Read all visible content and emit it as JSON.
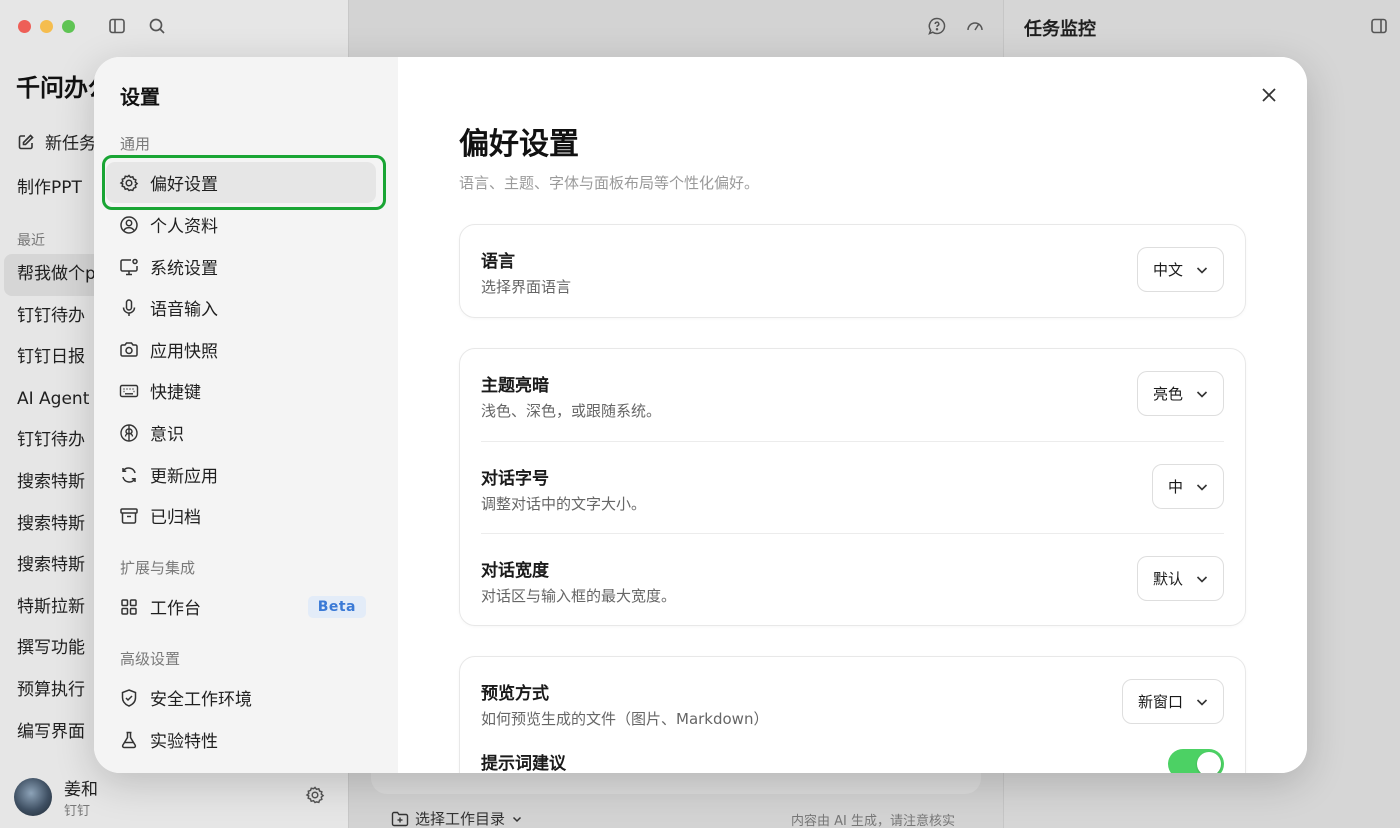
{
  "background": {
    "brand": "千问办公",
    "new_task": "新任务",
    "make_ppt": "制作PPT",
    "recent_label": "最近",
    "recent_items": [
      "帮我做个p",
      "钉钉待办",
      "钉钉日报",
      "AI Agent",
      "钉钉待办",
      "搜索特斯",
      "搜索特斯",
      "搜索特斯",
      "特斯拉新",
      "撰写功能",
      "预算执行",
      "编写界面"
    ],
    "user_name": "姜和",
    "user_org": "钉钉",
    "workdir": "选择工作目录",
    "disclaimer": "内容由 AI 生成，请注意核实",
    "right_panel_title": "任务监控"
  },
  "settings": {
    "title": "设置",
    "sections": {
      "general": "通用",
      "extensions": "扩展与集成",
      "advanced": "高级设置"
    },
    "nav": {
      "preferences": "偏好设置",
      "profile": "个人资料",
      "system": "系统设置",
      "voice": "语音输入",
      "snapshot": "应用快照",
      "shortcuts": "快捷键",
      "consciousness": "意识",
      "update": "更新应用",
      "archived": "已归档",
      "workbench": "工作台",
      "workbench_badge": "Beta",
      "secure_env": "安全工作环境",
      "experimental": "实验特性"
    },
    "selected": "偏好设置"
  },
  "preferences": {
    "title": "偏好设置",
    "subtitle": "语言、主题、字体与面板布局等个性化偏好。",
    "language": {
      "label": "语言",
      "desc": "选择界面语言",
      "value": "中文"
    },
    "theme": {
      "label": "主题亮暗",
      "desc": "浅色、深色，或跟随系统。",
      "value": "亮色"
    },
    "font_size": {
      "label": "对话字号",
      "desc": "调整对话中的文字大小。",
      "value": "中"
    },
    "width": {
      "label": "对话宽度",
      "desc": "对话区与输入框的最大宽度。",
      "value": "默认"
    },
    "preview": {
      "label": "预览方式",
      "desc": "如何预览生成的文件（图片、Markdown）",
      "value": "新窗口"
    },
    "prompt_suggest": {
      "label": "提示词建议",
      "enabled": true
    }
  },
  "colors": {
    "highlight": "#19a534",
    "toggle_on": "#4cd164",
    "beta_text": "#3b7ad6"
  }
}
